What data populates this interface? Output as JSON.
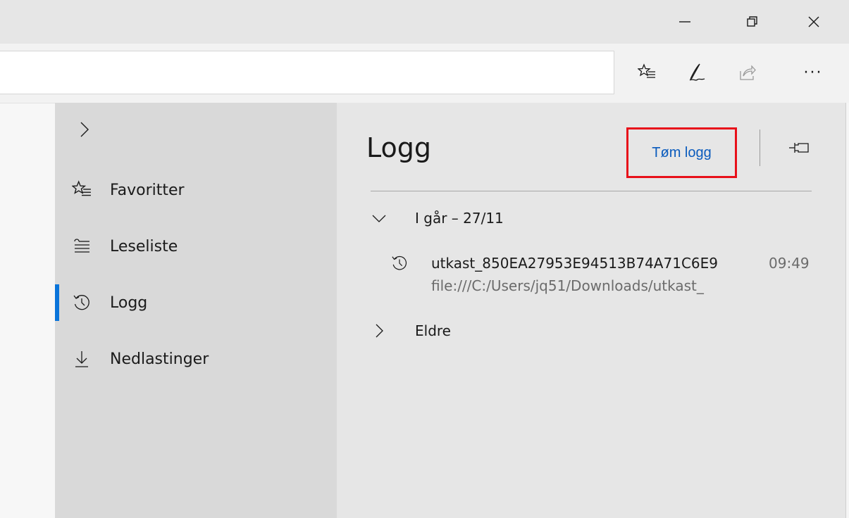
{
  "window": {
    "minimize_icon": "minimize-icon",
    "maximize_icon": "restore-icon",
    "close_icon": "close-icon"
  },
  "toolbar": {
    "address_value": "",
    "icons": [
      "favorites-star-icon",
      "pen-notes-icon",
      "share-icon",
      "more-icon"
    ],
    "more_label": "···"
  },
  "hub": {
    "nav_items": [
      {
        "label": "Favoritter",
        "icon": "favorites-star-icon"
      },
      {
        "label": "Leseliste",
        "icon": "reading-list-icon"
      },
      {
        "label": "Logg",
        "icon": "history-icon",
        "active": true
      },
      {
        "label": "Nedlastinger",
        "icon": "download-icon"
      }
    ],
    "accent_color": "#0a74da"
  },
  "panel": {
    "title": "Logg",
    "clear_label": "Tøm logg",
    "highlight_color": "#e8101a",
    "groups": [
      {
        "label": "I går – 27/11",
        "expanded": true,
        "entries": [
          {
            "title": "utkast_850EA27953E94513B74A71C6E9",
            "time": "09:49",
            "url": "file:///C:/Users/jq51/Downloads/utkast_"
          }
        ]
      },
      {
        "label": "Eldre",
        "expanded": false
      }
    ]
  }
}
